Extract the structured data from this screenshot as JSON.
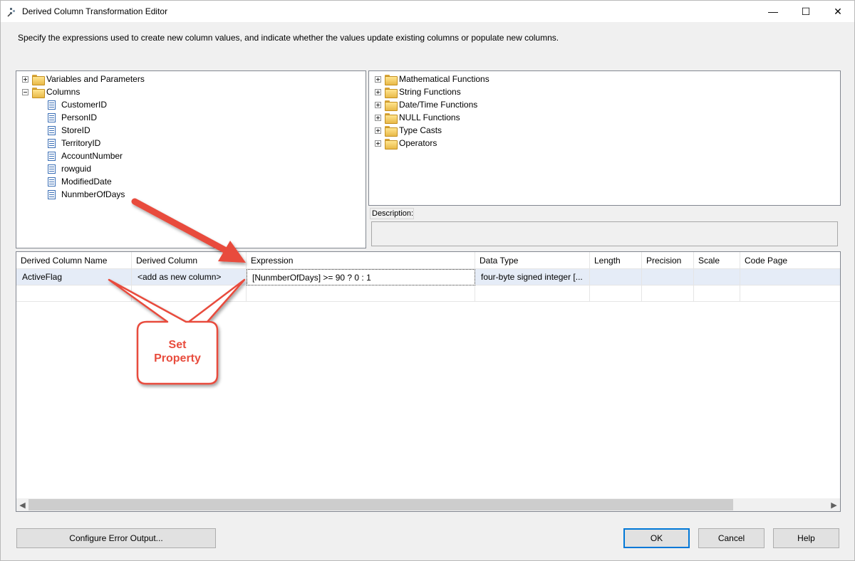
{
  "window": {
    "title": "Derived Column Transformation Editor",
    "minimize_glyph": "—",
    "maximize_glyph": "☐",
    "close_glyph": "✕"
  },
  "intro_text": "Specify the expressions used to create new column values, and indicate whether the values update existing columns or populate new columns.",
  "left_tree": {
    "groups": [
      {
        "label": "Variables and Parameters",
        "expanded": false,
        "icon": "folder-icon"
      },
      {
        "label": "Columns",
        "expanded": true,
        "icon": "folder-icon"
      }
    ],
    "columns": [
      "CustomerID",
      "PersonID",
      "StoreID",
      "TerritoryID",
      "AccountNumber",
      "rowguid",
      "ModifiedDate",
      "NunmberOfDays"
    ]
  },
  "right_tree": {
    "items": [
      "Mathematical Functions",
      "String Functions",
      "Date/Time Functions",
      "NULL Functions",
      "Type Casts",
      "Operators"
    ]
  },
  "description": {
    "label": "Description:",
    "value": ""
  },
  "grid": {
    "headers": [
      "Derived Column Name",
      "Derived Column",
      "Expression",
      "Data Type",
      "Length",
      "Precision",
      "Scale",
      "Code Page"
    ],
    "rows": [
      [
        "ActiveFlag",
        "<add as new column>",
        "[NunmberOfDays] >= 90 ? 0 : 1",
        "four-byte signed integer [...",
        "",
        "",
        "",
        ""
      ]
    ]
  },
  "buttons": {
    "configure_error_output": "Configure Error Output...",
    "ok": "OK",
    "cancel": "Cancel",
    "help": "Help"
  },
  "annotation": {
    "callout_line1": "Set",
    "callout_line2": "Property",
    "color": "#e84c3d"
  }
}
